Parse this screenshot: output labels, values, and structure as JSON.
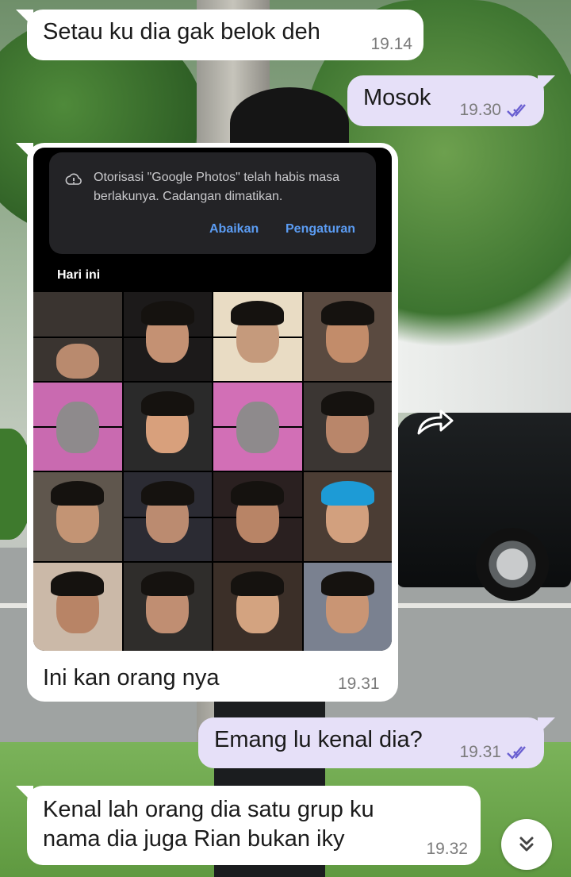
{
  "messages": [
    {
      "id": "m1",
      "direction": "incoming",
      "text": "Setau ku dia gak belok deh",
      "time": "19.14"
    },
    {
      "id": "m2",
      "direction": "outgoing",
      "text": "Mosok",
      "time": "19.30",
      "status": "read"
    },
    {
      "id": "m3",
      "direction": "incoming",
      "type": "image",
      "caption": "Ini kan orang nya",
      "time": "19.31"
    },
    {
      "id": "m4",
      "direction": "outgoing",
      "text": "Emang lu kenal dia?",
      "time": "19.31",
      "status": "read"
    },
    {
      "id": "m5",
      "direction": "incoming",
      "text": "Kenal lah orang dia satu grup ku nama dia juga Rian bukan iky",
      "time": "19.32"
    }
  ],
  "screenshot": {
    "notification_text": "Otorisasi \"Google Photos\" telah habis masa berlakunya. Cadangan dimatikan.",
    "button_ignore": "Abaikan",
    "button_settings": "Pengaturan",
    "section_label": "Hari ini",
    "thumbnail_count": 16
  },
  "icons": {
    "forward": "forward-icon",
    "scroll_down": "chevron-double-down-icon",
    "read_receipt": "double-check-icon",
    "notification": "cloud-alert-icon"
  },
  "colors": {
    "incoming_bubble": "#ffffff",
    "outgoing_bubble": "#e6e0f8",
    "read_tick": "#6a5fd1",
    "link_blue": "#5b9cf3"
  }
}
